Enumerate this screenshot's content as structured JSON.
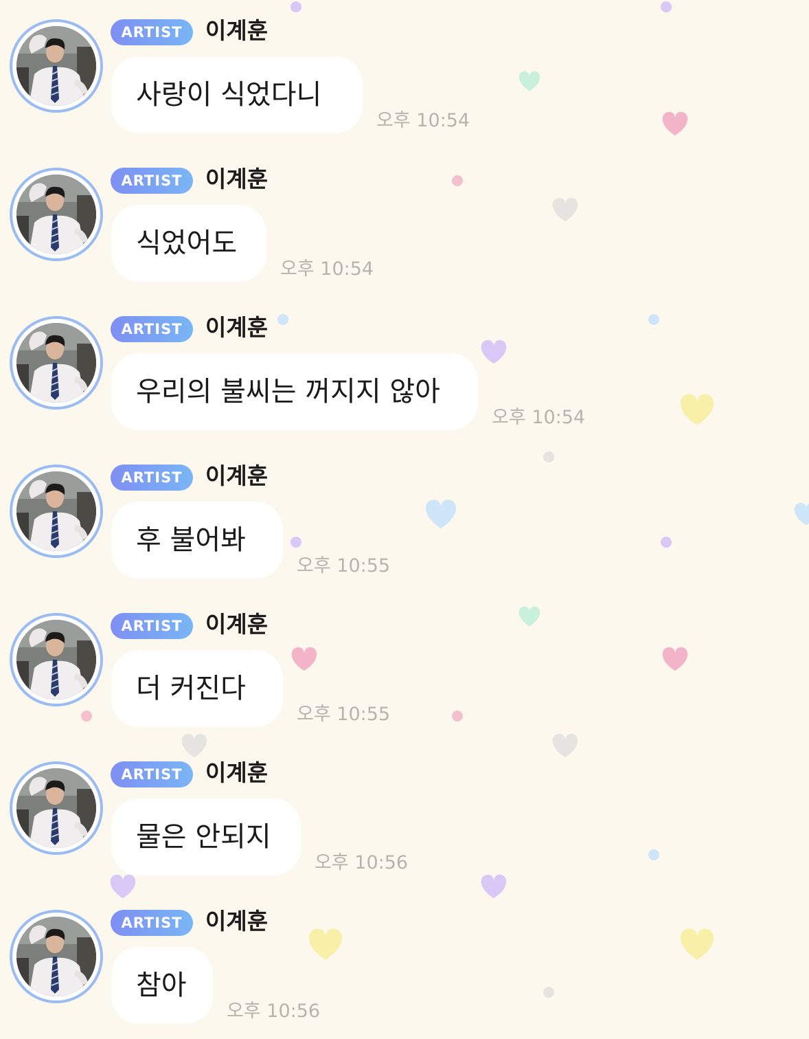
{
  "chat": {
    "messages": [
      {
        "badge": "ARTIST",
        "sender": "이계훈",
        "text": "사랑이 식었다니",
        "time": "오후 10:54"
      },
      {
        "badge": "ARTIST",
        "sender": "이계훈",
        "text": "식었어도",
        "time": "오후 10:54"
      },
      {
        "badge": "ARTIST",
        "sender": "이계훈",
        "text": "우리의 불씨는 꺼지지 않아",
        "time": "오후 10:54"
      },
      {
        "badge": "ARTIST",
        "sender": "이계훈",
        "text": "후 불어봐",
        "time": "오후 10:55"
      },
      {
        "badge": "ARTIST",
        "sender": "이계훈",
        "text": "더 커진다",
        "time": "오후 10:55"
      },
      {
        "badge": "ARTIST",
        "sender": "이계훈",
        "text": "물은 안되지",
        "time": "오후 10:56"
      },
      {
        "badge": "ARTIST",
        "sender": "이계훈",
        "text": "참아",
        "time": "오후 10:56"
      }
    ]
  },
  "colors": {
    "background": "#fcf8ee",
    "badge_gradient_start": "#7e8ff3",
    "badge_gradient_end": "#79b6f5",
    "avatar_ring": "#9bbcf2",
    "timestamp": "#b6b4ad"
  },
  "icons": {
    "avatar": "profile-photo",
    "background_decor": "heart-and-dot-pattern"
  }
}
